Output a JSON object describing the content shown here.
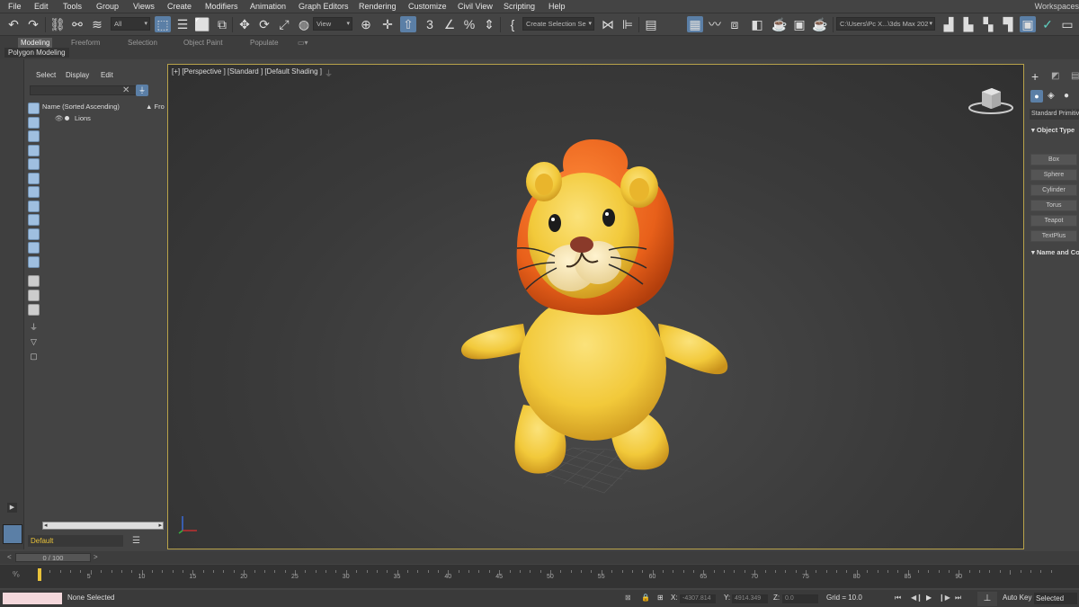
{
  "menu": [
    "File",
    "Edit",
    "Tools",
    "Group",
    "Views",
    "Create",
    "Modifiers",
    "Animation",
    "Graph Editors",
    "Rendering",
    "Customize",
    "Civil View",
    "Scripting",
    "Help"
  ],
  "workspace_label": "Workspaces",
  "toolbar": {
    "filter_value": "All",
    "ref_coord_value": "View",
    "selection_set_value": "Create Selection Se",
    "project_path_value": "C:\\Users\\Pc X...\\3ds Max 202"
  },
  "ribbon": {
    "tabs": [
      "Modeling",
      "Freeform",
      "Selection",
      "Object Paint",
      "Populate"
    ],
    "active_tab": "Modeling",
    "sub_label": "Polygon Modeling"
  },
  "scene_explorer": {
    "tabs": [
      "Select",
      "Display",
      "Edit"
    ],
    "column_header": "Name (Sorted Ascending)",
    "column_header2": "▲ Fro",
    "items": [
      "Lions"
    ],
    "layer_value": "Default"
  },
  "viewport": {
    "label": "[+] [Perspective ] [Standard ] [Default Shading ]"
  },
  "command_panel": {
    "category": "Standard Primitives",
    "object_type_header": "Object Type",
    "buttons": [
      "Box",
      "Sphere",
      "Cylinder",
      "Torus",
      "Teapot",
      "TextPlus"
    ],
    "name_color_header": "Name and Color"
  },
  "timeline": {
    "frame_display": "0 / 100",
    "ticks": [
      5,
      10,
      15,
      20,
      25,
      30,
      35,
      40,
      45,
      50,
      55,
      60,
      65,
      70,
      75,
      80,
      85,
      90
    ],
    "current_frame": 0,
    "total_frames": 100
  },
  "status": {
    "selection": "None Selected",
    "x_label": "X:",
    "x_value": "-4307.814",
    "y_label": "Y:",
    "y_value": "4914.349",
    "z_label": "Z:",
    "z_value": "0.0",
    "grid": "Grid = 10.0",
    "autokey": "Auto Key",
    "selected": "Selected"
  },
  "colors": {
    "viewport_border": "#b8a24a",
    "accent": "#5b7fa6",
    "lion_body": "#f2c93a",
    "lion_mane": "#e8601a",
    "layer_text": "#e8c23a"
  }
}
